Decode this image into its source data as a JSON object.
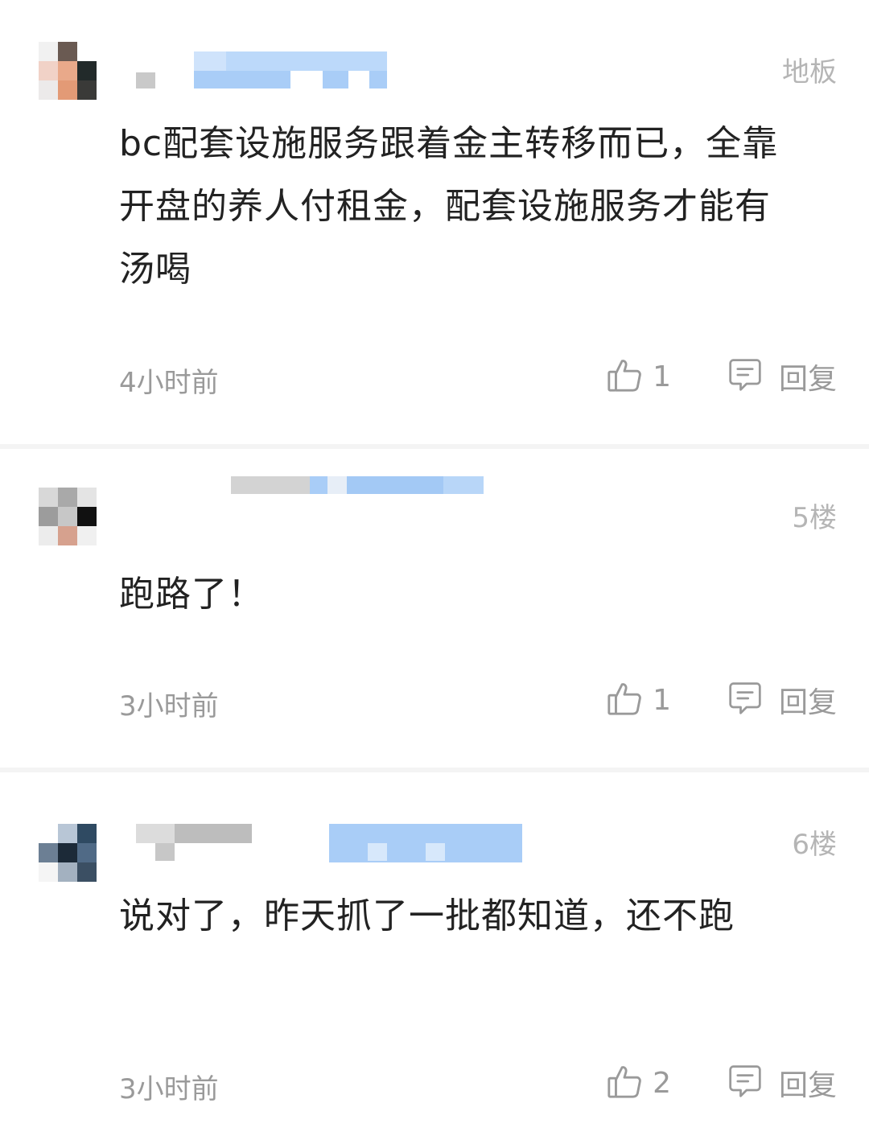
{
  "comments": [
    {
      "floor": "地板",
      "text": "bc配套设施服务跟着金主转移而已，全靠开盘的养人付租金，配套设施服务才能有汤喝",
      "time": "4小时前",
      "likes": "1",
      "reply_label": "回复"
    },
    {
      "floor": "5楼",
      "text": "跑路了！",
      "time": "3小时前",
      "likes": "1",
      "reply_label": "回复"
    },
    {
      "floor": "6楼",
      "text": "说对了，昨天抓了一批都知道，还不跑",
      "time": "3小时前",
      "likes": "2",
      "reply_label": "回复"
    }
  ],
  "icons": {
    "like": "thumbs-up-icon",
    "reply": "comment-bubble-icon"
  },
  "colors": {
    "meta_gray": "#9a9a9a",
    "floor_gray": "#b5b5b5",
    "text": "#222222",
    "redaction_blue": "#a9cdf7",
    "redaction_gray": "#cfcfcf"
  }
}
